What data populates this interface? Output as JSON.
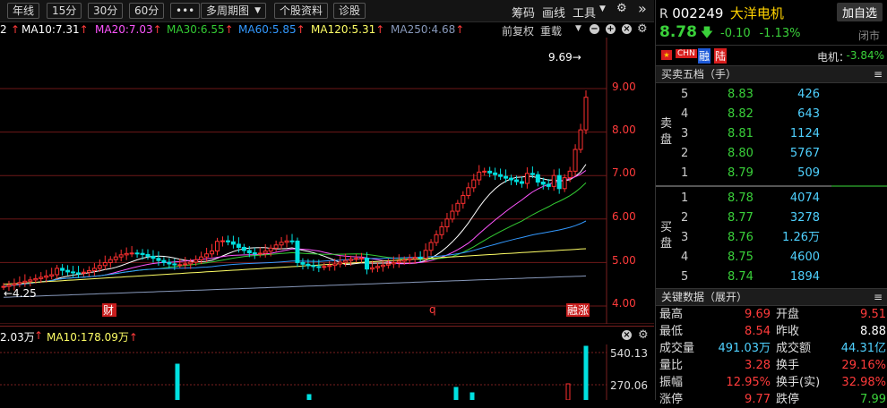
{
  "toolbar": {
    "tabs": [
      "年线",
      "15分",
      "30分",
      "60分",
      "•••",
      "多周期图",
      "个股资料",
      "诊股"
    ],
    "right_links": [
      "筹码",
      "画线",
      "工具"
    ],
    "collapse_glyph": "»"
  },
  "ma_bar": {
    "partial": "2",
    "items": [
      {
        "label": "MA10:7.31",
        "arrow": "↑",
        "color": "#ffffff"
      },
      {
        "label": "MA20:7.03",
        "arrow": "↑",
        "color": "#ff55ff"
      },
      {
        "label": "MA30:6.55",
        "arrow": "↑",
        "color": "#33cc33"
      },
      {
        "label": "MA60:5.85",
        "arrow": "↑",
        "color": "#3399ff"
      },
      {
        "label": "MA120:5.31",
        "arrow": "↑",
        "color": "#ffff66"
      },
      {
        "label": "MA250:4.68",
        "arrow": "↑",
        "color": "#8899bb"
      }
    ],
    "adjust": "前复权",
    "overlay": "重载"
  },
  "chart": {
    "y_ticks": [
      "9.00",
      "8.00",
      "7.00",
      "6.00",
      "5.00",
      "4.00"
    ],
    "high_label": "9.69→",
    "low_label": "←4.25",
    "markers": [
      "财",
      "q",
      "融"
    ],
    "marker_last_suffix": "涨"
  },
  "chart_data": {
    "type": "candlestick",
    "y_unit": "CNY",
    "ylim": [
      3.9,
      9.9
    ],
    "close_recent": [
      7.05,
      7.02,
      6.85,
      6.8,
      6.75,
      7.0,
      6.7,
      6.95,
      7.1,
      7.6,
      8.05,
      8.8
    ],
    "high": 9.69,
    "low": 4.25,
    "ma_lines": [
      "MA10",
      "MA20",
      "MA30",
      "MA60",
      "MA120",
      "MA250"
    ]
  },
  "volume": {
    "label_partial": "2.03万",
    "ma10_label": "MA10:178.09万",
    "arrow": "↑",
    "ticks": [
      "540.13",
      "270.06"
    ]
  },
  "quote": {
    "prefix": "R",
    "code": "002249",
    "name": "大洋电机",
    "add_button": "加自选",
    "price": "8.78",
    "change": "-0.10",
    "change_pct": "-1.13%",
    "status": "闭市",
    "tags": [
      "CHN",
      "融",
      "陆"
    ],
    "sector_label": "电机：",
    "sector_change": "-3.84%"
  },
  "order_book": {
    "title": "买卖五档（手）",
    "sell_label": [
      "卖",
      "盘"
    ],
    "buy_label": [
      "买",
      "盘"
    ],
    "sell": [
      {
        "level": "5",
        "price": "8.83",
        "vol": "426"
      },
      {
        "level": "4",
        "price": "8.82",
        "vol": "643"
      },
      {
        "level": "3",
        "price": "8.81",
        "vol": "1124"
      },
      {
        "level": "2",
        "price": "8.80",
        "vol": "5767"
      },
      {
        "level": "1",
        "price": "8.79",
        "vol": "509"
      }
    ],
    "buy": [
      {
        "level": "1",
        "price": "8.78",
        "vol": "4074"
      },
      {
        "level": "2",
        "price": "8.77",
        "vol": "3278"
      },
      {
        "level": "3",
        "price": "8.76",
        "vol": "1.26万"
      },
      {
        "level": "4",
        "price": "8.75",
        "vol": "4600"
      },
      {
        "level": "5",
        "price": "8.74",
        "vol": "1894"
      }
    ]
  },
  "key_data": {
    "title": "关键数据（展开）",
    "rows": [
      {
        "l1": "最高",
        "v1": "9.69",
        "c1": "red",
        "l2": "开盘",
        "v2": "9.51",
        "c2": "red"
      },
      {
        "l1": "最低",
        "v1": "8.54",
        "c1": "red",
        "l2": "昨收",
        "v2": "8.88",
        "c2": "white"
      },
      {
        "l1": "成交量",
        "v1": "491.03万",
        "c1": "cyan",
        "l2": "成交额",
        "v2": "44.31亿",
        "c2": "cyan"
      },
      {
        "l1": "量比",
        "v1": "3.28",
        "c1": "red",
        "l2": "换手",
        "v2": "29.16%",
        "c2": "red"
      },
      {
        "l1": "振幅",
        "v1": "12.95%",
        "c1": "red",
        "l2": "换手(实)",
        "v2": "32.98%",
        "c2": "red"
      },
      {
        "l1": "涨停",
        "v1": "9.77",
        "c1": "red",
        "l2": "跌停",
        "v2": "7.99",
        "c2": "green"
      }
    ]
  }
}
